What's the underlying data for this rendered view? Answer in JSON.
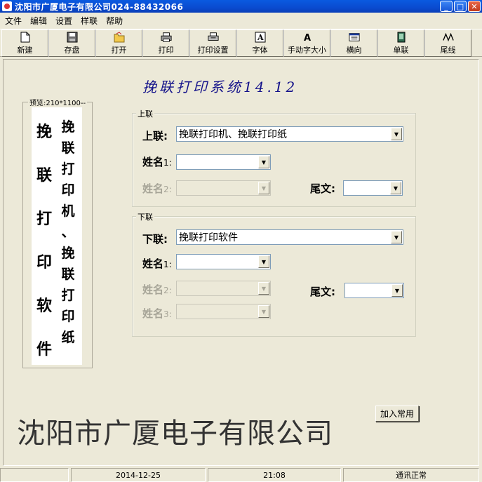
{
  "window": {
    "title": "沈阳市广厦电子有限公司024-88432066"
  },
  "menu": [
    "文件",
    "编辑",
    "设置",
    "样联",
    "帮助"
  ],
  "toolbar": [
    {
      "label": "新建",
      "icon": "new-file-icon"
    },
    {
      "label": "存盘",
      "icon": "save-disk-icon"
    },
    {
      "label": "打开",
      "icon": "open-folder-icon"
    },
    {
      "label": "打印",
      "icon": "printer-icon"
    },
    {
      "label": "打印设置",
      "icon": "print-setup-icon"
    },
    {
      "label": "字体",
      "icon": "font-icon"
    },
    {
      "label": "手动字大小",
      "icon": "font-size-icon"
    },
    {
      "label": "横向",
      "icon": "landscape-icon"
    },
    {
      "label": "单联",
      "icon": "single-icon"
    },
    {
      "label": "尾线",
      "icon": "tail-line-icon"
    }
  ],
  "app_title": "挽联打印系统14.12",
  "preview": {
    "legend": "预览:210*1100--",
    "left_text": [
      "挽",
      "联",
      "打",
      "印",
      "软",
      "件"
    ],
    "right_text": [
      "挽",
      "联",
      "打",
      "印",
      "机",
      "、",
      "挽",
      "联",
      "打",
      "印",
      "纸"
    ]
  },
  "upper": {
    "legend": "上联",
    "label": "上联:",
    "value": "挽联打印机、挽联打印纸",
    "name1": "姓名",
    "name1_num": "1:",
    "name2": "姓名",
    "name2_num": "2:",
    "tail": "尾文:"
  },
  "lower": {
    "legend": "下联",
    "label": "下联:",
    "value": "挽联打印软件",
    "name1": "姓名",
    "name1_num": "1:",
    "name2": "姓名",
    "name2_num": "2:",
    "name3": "姓名",
    "name3_num": "3:",
    "tail": "尾文:"
  },
  "company": "沈阳市广厦电子有限公司",
  "add_common_button": "加入常用",
  "status": {
    "date": "2014-12-25",
    "time": "21:08",
    "comm": "通讯正常"
  }
}
